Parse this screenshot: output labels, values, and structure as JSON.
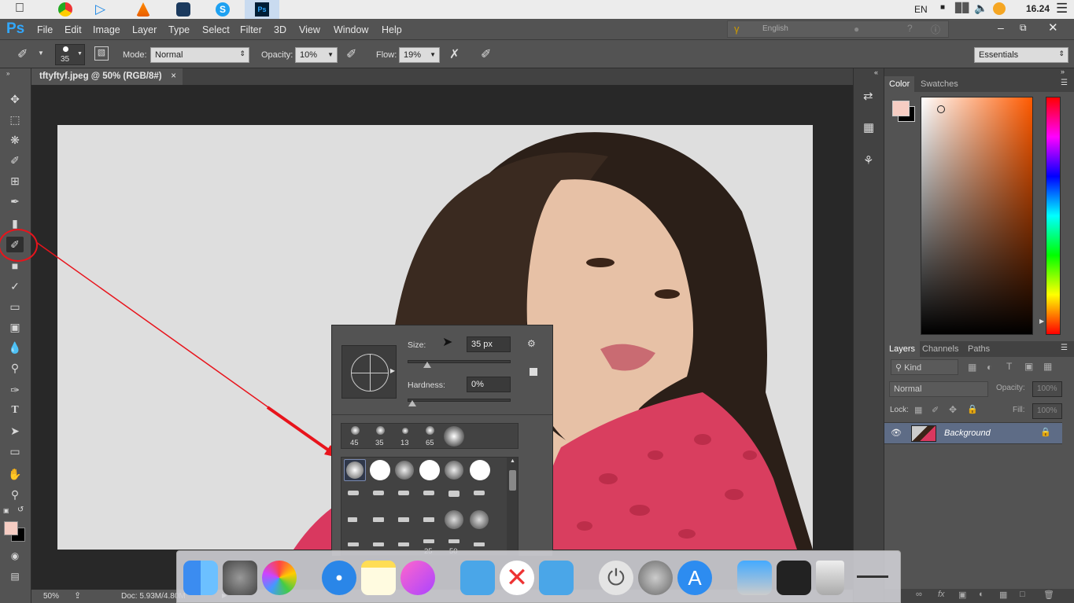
{
  "taskbar": {
    "lang": "EN",
    "time": "16.24"
  },
  "menubar": {
    "logo": "Ps",
    "items": [
      "File",
      "Edit",
      "Image",
      "Layer",
      "Type",
      "Select",
      "Filter",
      "3D",
      "View",
      "Window",
      "Help"
    ],
    "ime_label": "English"
  },
  "options": {
    "brush_size": "35",
    "mode_label": "Mode:",
    "mode_value": "Normal",
    "opacity_label": "Opacity:",
    "opacity_value": "10%",
    "flow_label": "Flow:",
    "flow_value": "19%",
    "workspace": "Essentials"
  },
  "document": {
    "tab_title": "tftyftyf.jpeg @ 50% (RGB/8#)",
    "zoom": "50%",
    "doc_info": "Doc: 5.93M/4.80M"
  },
  "brush_popup": {
    "size_label": "Size:",
    "size_value": "35 px",
    "hardness_label": "Hardness:",
    "hardness_value": "0%",
    "size_fraction": 0.18,
    "hardness_fraction": 0.0,
    "recent_sizes": [
      "45",
      "35",
      "13",
      "65"
    ],
    "grid_labels": [
      "25",
      "50"
    ]
  },
  "color_panel": {
    "tabs": [
      "Color",
      "Swatches"
    ],
    "foreground": "#f6cdc3",
    "background": "#000000"
  },
  "layers_panel": {
    "tabs": [
      "Layers",
      "Channels",
      "Paths"
    ],
    "kind_label": "Kind",
    "blend_mode": "Normal",
    "opacity_label": "Opacity:",
    "opacity_value": "100%",
    "lock_label": "Lock:",
    "fill_label": "Fill:",
    "fill_value": "100%",
    "layer_name": "Background"
  },
  "colors": {
    "accent_red": "#e8141c",
    "ps_blue": "#31a8ff"
  }
}
